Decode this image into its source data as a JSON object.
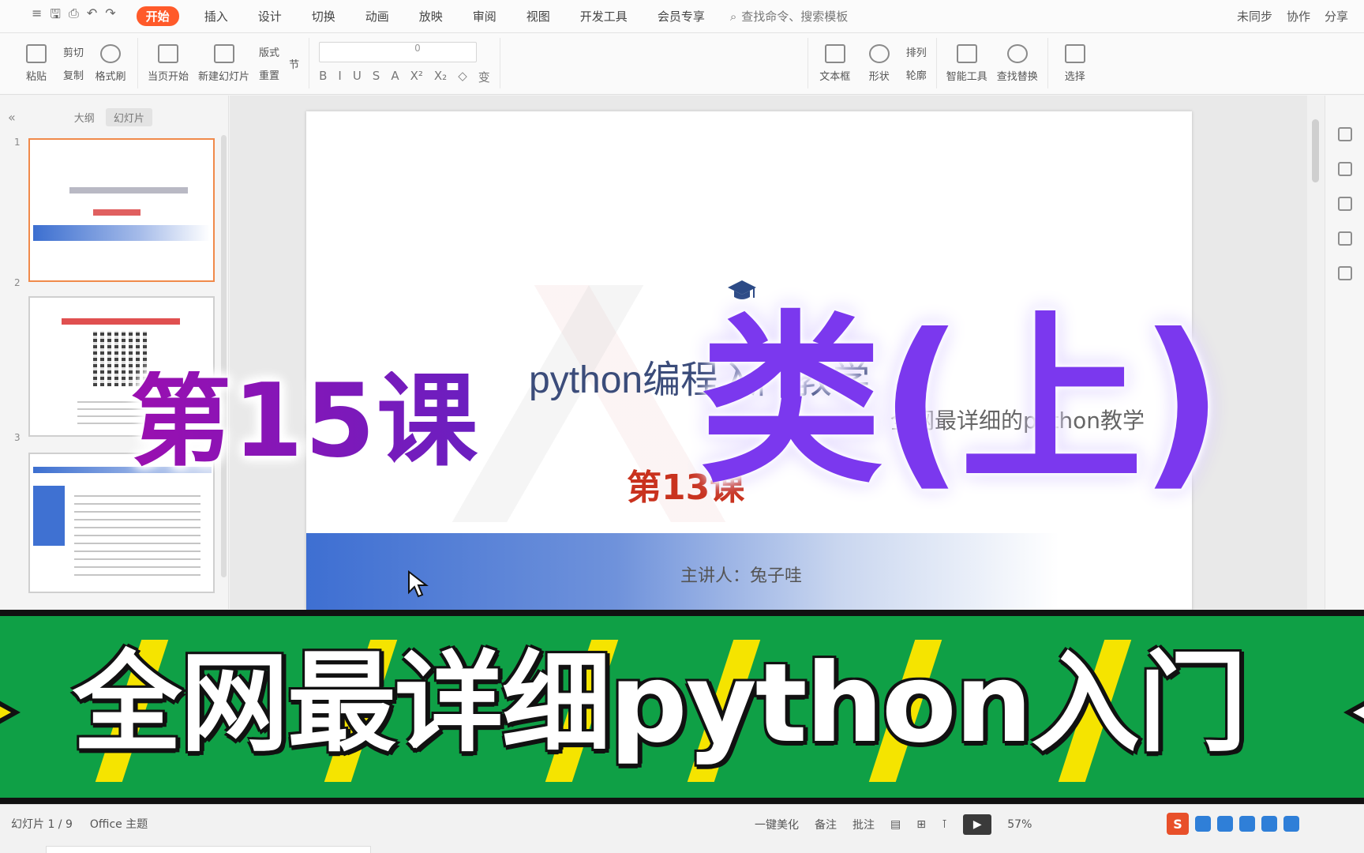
{
  "menubar": {
    "quick_access": [
      "≡",
      "🖫",
      "⎙",
      "↶",
      "↷"
    ],
    "tabs": [
      "开始",
      "插入",
      "设计",
      "切换",
      "动画",
      "放映",
      "审阅",
      "视图",
      "开发工具",
      "会员专享"
    ],
    "active_tab": "开始",
    "search_placeholder": "查找命令、搜索模板",
    "right_items": [
      "未同步",
      "协作",
      "分享"
    ]
  },
  "ribbon": {
    "clipboard": [
      "粘贴",
      "剪切",
      "复制",
      "格式刷"
    ],
    "slides": [
      "当页开始",
      "新建幻灯片",
      "版式",
      "重置",
      "节"
    ],
    "font_size": "0",
    "format_buttons": [
      "B",
      "I",
      "U",
      "S",
      "A",
      "X²",
      "X₂",
      "◇",
      "变"
    ],
    "insert_group": [
      "文本框",
      "形状",
      "排列",
      "轮廓"
    ],
    "tools": [
      "智能工具",
      "查找替换"
    ],
    "selection": "选择"
  },
  "left_panel": {
    "tab_outline": "大纲",
    "tab_slides": "幻灯片",
    "slide_numbers": [
      "1",
      "2",
      "3"
    ]
  },
  "slide": {
    "title": "python编程入门教学",
    "subtitle": "全网最详细的python教学",
    "lesson": "第13课",
    "presenter": "主讲人：兔子哇"
  },
  "overlay": {
    "lesson_title": "第15课",
    "topic_title": "类(上)",
    "banner": "全网最详细python入门"
  },
  "statusbar": {
    "slide_info": "幻灯片 1 / 9",
    "theme": "Office 主题",
    "beautify": "一键美化",
    "notes": "备注",
    "comments": "批注",
    "zoom": "57%"
  },
  "colors": {
    "accent_tab": "#ff5a2a",
    "banner_green": "#0fa046",
    "topic_purple": "#7b38ee",
    "lesson_red": "#c9321e"
  }
}
